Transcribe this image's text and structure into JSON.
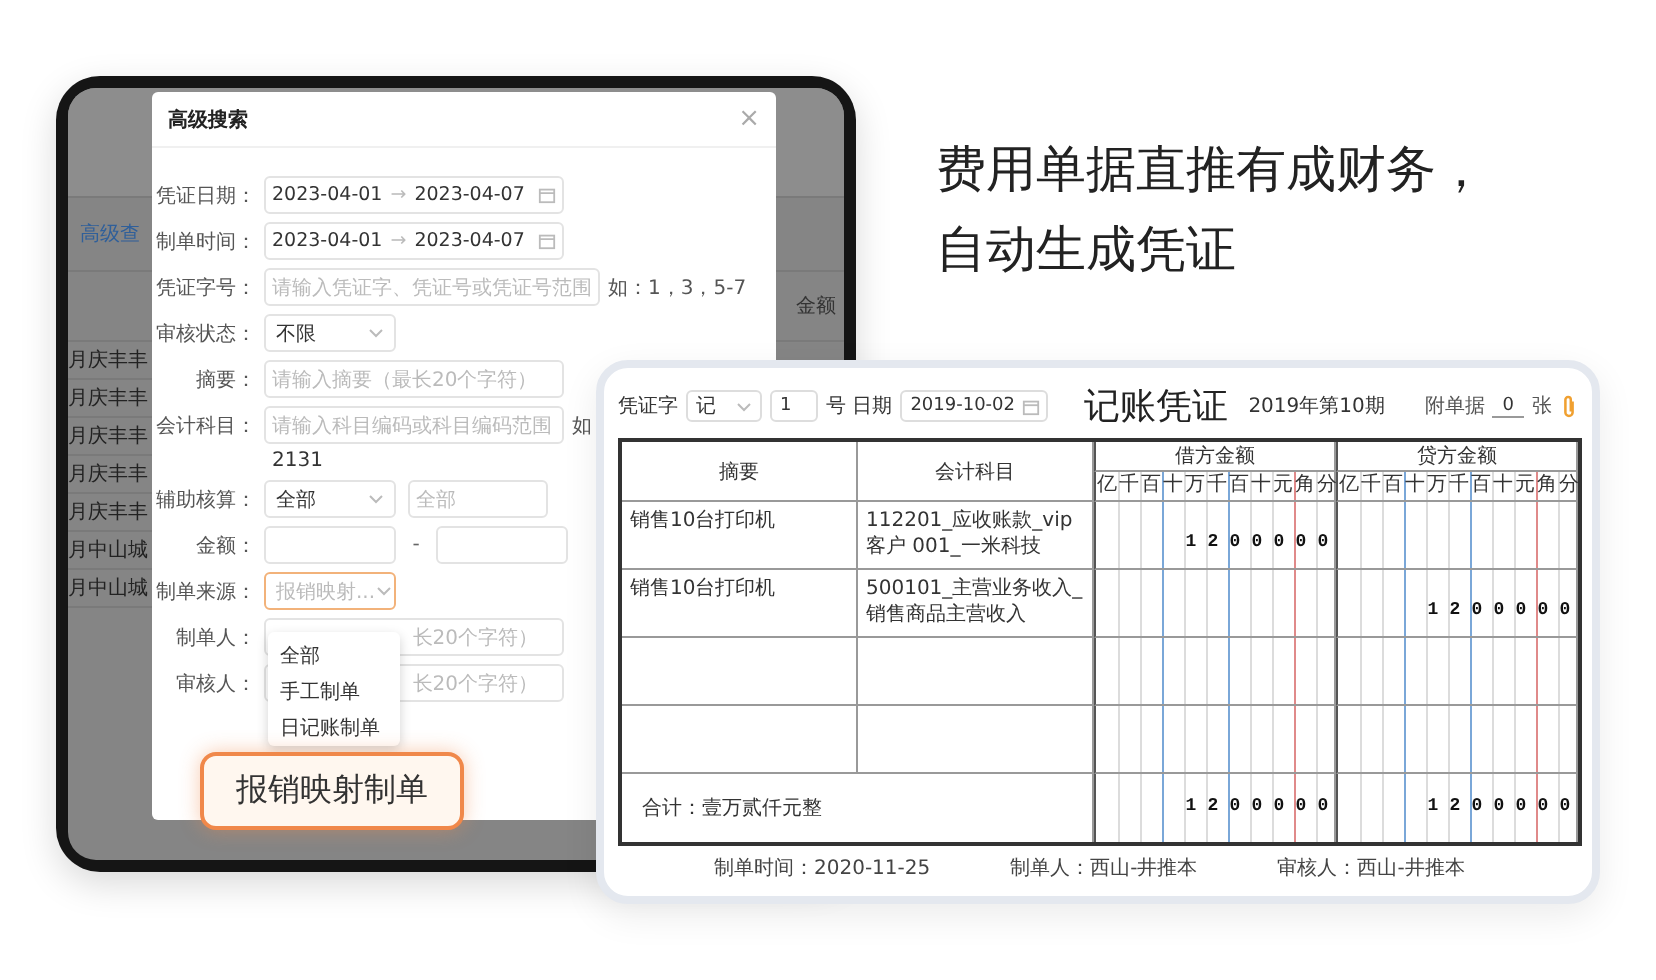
{
  "headline": [
    "费用单据直推有成财务，",
    "自动生成凭证"
  ],
  "back_app": {
    "link": "高级查",
    "column_header": "金额",
    "rows": [
      "月庆丰丰",
      "月庆丰丰",
      "月庆丰丰",
      "月庆丰丰",
      "月庆丰丰",
      "月中山城",
      "月中山城"
    ]
  },
  "search_dialog": {
    "title": "高级搜索",
    "close": "×",
    "fields": [
      {
        "kind": "date_range",
        "label": "凭证日期：",
        "from": "2023-04-01",
        "separator": "→",
        "to": "2023-04-07"
      },
      {
        "kind": "date_range",
        "label": "制单时间：",
        "from": "2023-04-01",
        "separator": "→",
        "to": "2023-04-07"
      },
      {
        "kind": "input",
        "label": "凭证字号：",
        "placeholder": "请输入凭证字、凭证号或凭证号范围",
        "hint": "如：1，3，5-7"
      },
      {
        "kind": "select",
        "label": "审核状态：",
        "value": "不限"
      },
      {
        "kind": "input",
        "label": "摘要：",
        "placeholder": "请输入摘要（最长20个字符）"
      },
      {
        "kind": "input",
        "label": "会计科目：",
        "placeholder": "请输入科目编码或科目编码范围",
        "hint": "如",
        "note": "2131"
      },
      {
        "kind": "select_pair",
        "label": "辅助核算：",
        "value": "全部",
        "placeholder": "全部"
      },
      {
        "kind": "range",
        "label": "金额：",
        "separator": "-"
      },
      {
        "kind": "select",
        "label": "制单来源：",
        "placeholder": "报销映射...",
        "focused": true
      },
      {
        "kind": "covered_input",
        "label": "制单人：",
        "placeholder": "长20个字符）"
      },
      {
        "kind": "covered_input",
        "label": "审核人：",
        "placeholder": "长20个字符）"
      }
    ],
    "dropdown": {
      "options": [
        "全部",
        "手工制单",
        "日记账制单"
      ]
    }
  },
  "callout": "报销映射制单",
  "voucher": {
    "word_label": "凭证字",
    "word": "记",
    "number": "1",
    "date_label": "号 日期",
    "date": "2019-10-02",
    "title": "记账凭证",
    "period": "2019年第10期",
    "attach_label": "附单据",
    "attach": "0",
    "attach_unit": "张",
    "columns": [
      {
        "title": "摘要"
      },
      {
        "title": "会计科目"
      },
      {
        "title": "借方金额",
        "units": [
          "亿",
          "千",
          "百",
          "十",
          "万",
          "千",
          "百",
          "十",
          "元",
          "角",
          "分"
        ]
      },
      {
        "title": "贷方金额",
        "units": [
          "亿",
          "千",
          "百",
          "十",
          "万",
          "千",
          "百",
          "十",
          "元",
          "角",
          "分"
        ]
      }
    ],
    "rows": [
      {
        "kind": "entry",
        "summary": "销售10台打印机",
        "account": "112201_应收账款_vip客户 001_一米科技",
        "debit": "1200000"
      },
      {
        "kind": "entry",
        "summary": "销售10台打印机",
        "account": "500101_主营业务收入_销售商品主营收入",
        "credit": "1200000"
      },
      {
        "kind": "blank"
      },
      {
        "kind": "blank"
      }
    ],
    "total": {
      "label": "合计：壹万贰仟元整",
      "debit": "1200000",
      "credit": "1200000"
    },
    "footer": [
      "制单时间：2020-11-25",
      "制单人：西山-井推本",
      "审核人：西山-井推本"
    ]
  }
}
